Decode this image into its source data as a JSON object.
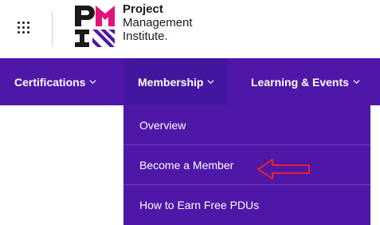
{
  "header": {
    "logo": {
      "line1": "Project",
      "line2": "Management",
      "line3": "Institute"
    }
  },
  "nav": {
    "items": [
      {
        "label": "Certifications"
      },
      {
        "label": "Membership"
      },
      {
        "label": "Learning & Events"
      }
    ]
  },
  "dropdown": {
    "items": [
      {
        "label": "Overview"
      },
      {
        "label": "Become a Member"
      },
      {
        "label": "How to Earn Free PDUs"
      }
    ]
  },
  "colors": {
    "brand_purple": "#4f17a8",
    "logo_magenta": "#e4117a",
    "arrow_red": "#e8202a"
  },
  "annotation": {
    "icon": "left-arrow-annotation-icon"
  }
}
